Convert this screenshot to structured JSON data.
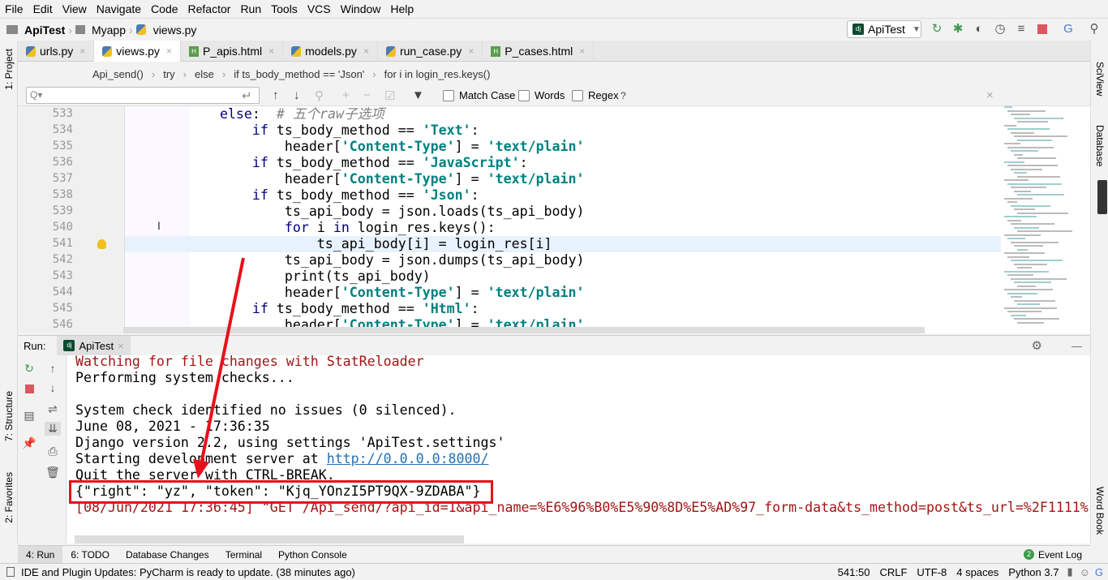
{
  "menu": [
    "File",
    "Edit",
    "View",
    "Navigate",
    "Code",
    "Refactor",
    "Run",
    "Tools",
    "VCS",
    "Window",
    "Help"
  ],
  "nav": {
    "project": "ApiTest",
    "folder": "Myapp",
    "file": "views.py"
  },
  "run_config": "ApiTest",
  "toolbar_icons": [
    "rerun-icon",
    "debug-icon",
    "coverage-icon",
    "profile-icon",
    "concurrency-icon",
    "stop-icon",
    "translate-icon",
    "search-icon"
  ],
  "tabs": [
    {
      "label": "urls.py",
      "type": "py"
    },
    {
      "label": "views.py",
      "type": "py",
      "active": true
    },
    {
      "label": "P_apis.html",
      "type": "html"
    },
    {
      "label": "models.py",
      "type": "py"
    },
    {
      "label": "run_case.py",
      "type": "py"
    },
    {
      "label": "P_cases.html",
      "type": "html"
    }
  ],
  "breadcrumbs": [
    "Api_send()",
    "try",
    "else",
    "if ts_body_method == 'Json'",
    "for i in login_res.keys()"
  ],
  "find": {
    "placeholder": "Q▾",
    "match_case": "Match Case",
    "words": "Words",
    "regex": "Regex",
    "help": "?"
  },
  "left_tools": {
    "project": "1: Project",
    "structure": "7: Structure",
    "favorites": "2: Favorites"
  },
  "right_tools": {
    "sciview": "SciView",
    "database": "Database",
    "wordbook": "Word Book"
  },
  "editor": {
    "lines": [
      {
        "n": "533",
        "tokens": [
          [
            "        ",
            ""
          ],
          [
            "else",
            "kw"
          ],
          [
            ":  ",
            ""
          ],
          [
            "# 五个raw子选项",
            "cm"
          ]
        ]
      },
      {
        "n": "534",
        "tokens": [
          [
            "            ",
            ""
          ],
          [
            "if",
            "kw"
          ],
          [
            " ts_body_method == ",
            ""
          ],
          [
            "'Text'",
            "str"
          ],
          [
            ":",
            ""
          ]
        ]
      },
      {
        "n": "535",
        "tokens": [
          [
            "                header[",
            ""
          ],
          [
            "'Content-Type'",
            "str"
          ],
          [
            "] = ",
            ""
          ],
          [
            "'text/plain'",
            "str"
          ]
        ]
      },
      {
        "n": "536",
        "tokens": [
          [
            "            ",
            ""
          ],
          [
            "if",
            "kw"
          ],
          [
            " ts_body_method == ",
            ""
          ],
          [
            "'JavaScript'",
            "str"
          ],
          [
            ":",
            ""
          ]
        ]
      },
      {
        "n": "537",
        "tokens": [
          [
            "                header[",
            ""
          ],
          [
            "'Content-Type'",
            "str"
          ],
          [
            "] = ",
            ""
          ],
          [
            "'text/plain'",
            "str"
          ]
        ]
      },
      {
        "n": "538",
        "tokens": [
          [
            "            ",
            ""
          ],
          [
            "if",
            "kw"
          ],
          [
            " ts_body_method == ",
            ""
          ],
          [
            "'Json'",
            "str"
          ],
          [
            ":",
            ""
          ]
        ]
      },
      {
        "n": "539",
        "tokens": [
          [
            "                ts_api_body = json.loads(ts_api_body)",
            ""
          ]
        ]
      },
      {
        "n": "540",
        "tokens": [
          [
            "                ",
            ""
          ],
          [
            "for",
            "kw"
          ],
          [
            " i ",
            ""
          ],
          [
            "in",
            "kw"
          ],
          [
            " login_res.keys():",
            ""
          ]
        ]
      },
      {
        "n": "541",
        "tokens": [
          [
            "                    ts_api_body[i] = login_res[i]",
            ""
          ]
        ],
        "current": true
      },
      {
        "n": "542",
        "tokens": [
          [
            "                ts_api_body = json.dumps(ts_api_body)",
            ""
          ]
        ]
      },
      {
        "n": "543",
        "tokens": [
          [
            "                print(ts_api_body)",
            ""
          ]
        ]
      },
      {
        "n": "544",
        "tokens": [
          [
            "                header[",
            ""
          ],
          [
            "'Content-Type'",
            "str"
          ],
          [
            "] = ",
            ""
          ],
          [
            "'text/plain'",
            "str"
          ]
        ]
      },
      {
        "n": "545",
        "tokens": [
          [
            "            ",
            ""
          ],
          [
            "if",
            "kw"
          ],
          [
            " ts_body_method == ",
            ""
          ],
          [
            "'Html'",
            "str"
          ],
          [
            ":",
            ""
          ]
        ]
      },
      {
        "n": "546",
        "tokens": [
          [
            "                header[",
            ""
          ],
          [
            "'Content-Type'",
            "str"
          ],
          [
            "] = ",
            ""
          ],
          [
            "'text/plain'",
            "str"
          ]
        ]
      }
    ]
  },
  "run": {
    "label": "Run:",
    "tab": "ApiTest"
  },
  "console": [
    {
      "text": "Watching for file changes with StatReloader",
      "red": true
    },
    {
      "text": "Performing system checks..."
    },
    {
      "text": ""
    },
    {
      "text": "System check identified no issues (0 silenced)."
    },
    {
      "text": "June 08, 2021 - 17:36:35"
    },
    {
      "text": "Django version 2.2, using settings 'ApiTest.settings'"
    },
    {
      "text": "Starting development server at ",
      "link": "http://0.0.0.0:8000/"
    },
    {
      "text": "Quit the server with CTRL-BREAK."
    },
    {
      "text": "{\"right\": \"yz\", \"token\": \"Kjq_YOnzI5PT9QX-9ZDABA\"}",
      "highlight": true
    },
    {
      "text": "[08/Jun/2021 17:36:45] \"GET /Api_send/?api_id=1&api_name=%E6%96%B0%E5%90%8D%E5%AD%97_form-data&ts_method=post&ts_url=%2F1111%",
      "red": true
    }
  ],
  "bottom_tabs": [
    "4: Run",
    "6: TODO",
    "Database Changes",
    "Terminal",
    "Python Console"
  ],
  "event_log": {
    "count": "2",
    "label": "Event Log"
  },
  "status": {
    "message": "IDE and Plugin Updates: PyCharm is ready to update. (38 minutes ago)",
    "position": "541:50",
    "line_sep": "CRLF",
    "encoding": "UTF-8",
    "indent": "4 spaces",
    "interpreter": "Python 3.7"
  },
  "annotation_color": "#e8101a"
}
